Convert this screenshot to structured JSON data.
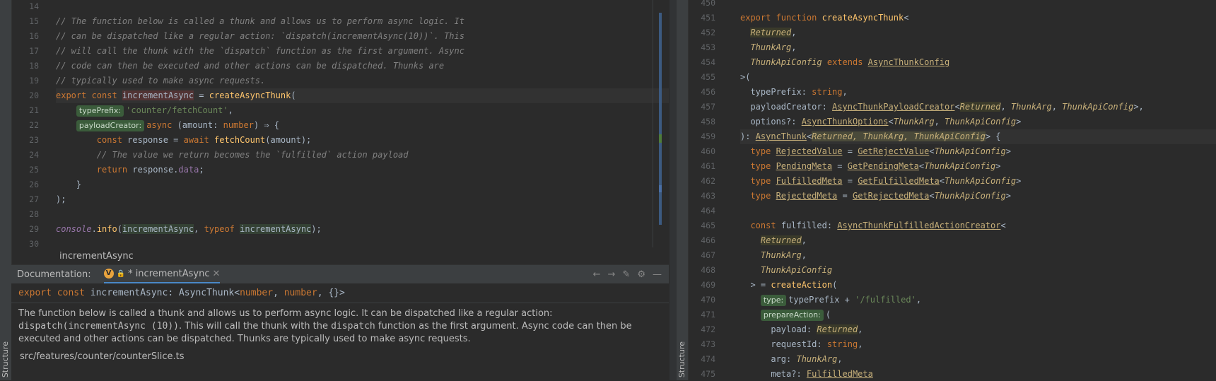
{
  "structure_label": "Structure",
  "left": {
    "lines": [
      {
        "n": "14",
        "html": ""
      },
      {
        "n": "15",
        "html": "<span class='cm'>// The function below is called a thunk and allows us to perform async logic. It</span>"
      },
      {
        "n": "16",
        "html": "<span class='cm'>// can be dispatched like a regular action: `dispatch(incrementAsync(10))`. This</span>"
      },
      {
        "n": "17",
        "html": "<span class='cm'>// will call the thunk with the `dispatch` function as the first argument. Async</span>"
      },
      {
        "n": "18",
        "html": "<span class='cm'>// code can then be executed and other actions can be dispatched. Thunks are</span>"
      },
      {
        "n": "19",
        "html": "<span class='cm'>// typically used to make async requests.</span>"
      },
      {
        "n": "20",
        "html": "<span class='kw'>export const </span><span style='background:#523334'>incrementAsync</span> = <span class='fn'>createAsyncThunk</span>(",
        "hl": true
      },
      {
        "n": "21",
        "html": "    <span class='hint'>typePrefix:</span><span class='str'>'counter/fetchCount'</span>,"
      },
      {
        "n": "22",
        "html": "    <span class='hint'>payloadCreator:</span><span class='kw'>async </span>(amount: <span class='kw'>number</span>) ⇒ {"
      },
      {
        "n": "23",
        "html": "        <span class='kw'>const </span>response = <span class='kw'>await </span><span class='fn'>fetchCount</span>(amount);"
      },
      {
        "n": "24",
        "html": "        <span class='cm'>// The value we return becomes the `fulfilled` action payload</span>"
      },
      {
        "n": "25",
        "html": "        <span class='kw'>return </span>response.<span class='pp'>data</span>;"
      },
      {
        "n": "26",
        "html": "    }"
      },
      {
        "n": "27",
        "html": ");"
      },
      {
        "n": "28",
        "html": ""
      },
      {
        "n": "29",
        "html": "<span class='pp' style='font-style:italic'>console</span>.<span class='fn'>info</span>(<span style='background:#344134'>incrementAsync</span>, <span class='kw'>typeof </span><span style='background:#344134'>incrementAsync</span>);"
      },
      {
        "n": "30",
        "html": ""
      }
    ],
    "breadcrumb": "incrementAsync"
  },
  "doc": {
    "title": "Documentation:",
    "tab_label": "* incrementAsync",
    "signature_html": "<span class='kw'>export const </span>incrementAsync: <span style='color:#a9b7c6'>AsyncThunk</span>&lt;<span class='kw'>number</span>, <span class='kw'>number</span>, {}&gt;",
    "description_html": "The function below is called a thunk and allows us to perform async logic. It can be dispatched like a regular action: <code>dispatch(incrementAsync (10))</code>. This will call the thunk with the <code>dispatch</code> function as the first argument. Async code can then be executed and other actions can be dispatched. Thunks are typically used to make async requests.",
    "path": "src/features/counter/counterSlice.ts"
  },
  "right": {
    "lines": [
      {
        "n": "450",
        "html": ""
      },
      {
        "n": "451",
        "html": "<span class='kw'>export function </span><span class='fn'>createAsyncThunk</span>&lt;"
      },
      {
        "n": "452",
        "html": "  <span class='it' style='background:#3a3a2a'>Returned</span>,"
      },
      {
        "n": "453",
        "html": "  <span class='it'>ThunkArg</span>,"
      },
      {
        "n": "454",
        "html": "  <span class='it'>ThunkApiConfig</span> <span class='kw'>extends </span><span class='ul'>AsyncThunkConfig</span>"
      },
      {
        "n": "455",
        "html": "&gt;("
      },
      {
        "n": "456",
        "html": "  typePrefix: <span class='kw'>string</span>,"
      },
      {
        "n": "457",
        "html": "  payloadCreator: <span class='ul'>AsyncThunkPayloadCreator</span>&lt;<span class='it' style='background:#3a3a2a'>Returned</span>, <span class='it'>ThunkArg</span>, <span class='it'>ThunkApiConfig</span>&gt;,"
      },
      {
        "n": "458",
        "html": "  options?: <span class='ul'>AsyncThunkOptions</span>&lt;<span class='it'>ThunkArg</span>, <span class='it'>ThunkApiConfig</span>&gt;"
      },
      {
        "n": "459",
        "html": "): <span class='ul'>AsyncThunk</span>&lt;<span class='it' style='background:#4a4a3a'>Returned, ThunkArg, ThunkApiConfig</span>&gt; {",
        "hl": true
      },
      {
        "n": "460",
        "html": "  <span class='kw'>type </span><span class='ul'>RejectedValue</span> = <span class='ul'>GetRejectValue</span>&lt;<span class='it'>ThunkApiConfig</span>&gt;"
      },
      {
        "n": "461",
        "html": "  <span class='kw'>type </span><span class='ul'>PendingMeta</span> = <span class='ul'>GetPendingMeta</span>&lt;<span class='it'>ThunkApiConfig</span>&gt;"
      },
      {
        "n": "462",
        "html": "  <span class='kw'>type </span><span class='ul'>FulfilledMeta</span> = <span class='ul'>GetFulfilledMeta</span>&lt;<span class='it'>ThunkApiConfig</span>&gt;"
      },
      {
        "n": "463",
        "html": "  <span class='kw'>type </span><span class='ul'>RejectedMeta</span> = <span class='ul'>GetRejectedMeta</span>&lt;<span class='it'>ThunkApiConfig</span>&gt;"
      },
      {
        "n": "464",
        "html": ""
      },
      {
        "n": "465",
        "html": "  <span class='kw'>const </span>fulfilled: <span class='ul'>AsyncThunkFulfilledActionCreator</span>&lt;"
      },
      {
        "n": "466",
        "html": "    <span class='it' style='background:#3a3a2a'>Returned</span>,"
      },
      {
        "n": "467",
        "html": "    <span class='it'>ThunkArg</span>,"
      },
      {
        "n": "468",
        "html": "    <span class='it'>ThunkApiConfig</span>"
      },
      {
        "n": "469",
        "html": "  &gt; = <span class='fn'>createAction</span>("
      },
      {
        "n": "470",
        "html": "    <span class='hint'>type:</span>typePrefix + <span class='str'>'/fulfilled'</span>,"
      },
      {
        "n": "471",
        "html": "    <span class='hint'>prepareAction:</span>("
      },
      {
        "n": "472",
        "html": "      payload: <span class='it' style='background:#3a3a2a'>Returned</span>,"
      },
      {
        "n": "473",
        "html": "      requestId: <span class='kw'>string</span>,"
      },
      {
        "n": "474",
        "html": "      arg: <span class='it'>ThunkArg</span>,"
      },
      {
        "n": "475",
        "html": "      meta?: <span class='ul'>FulfilledMeta</span>"
      }
    ]
  }
}
